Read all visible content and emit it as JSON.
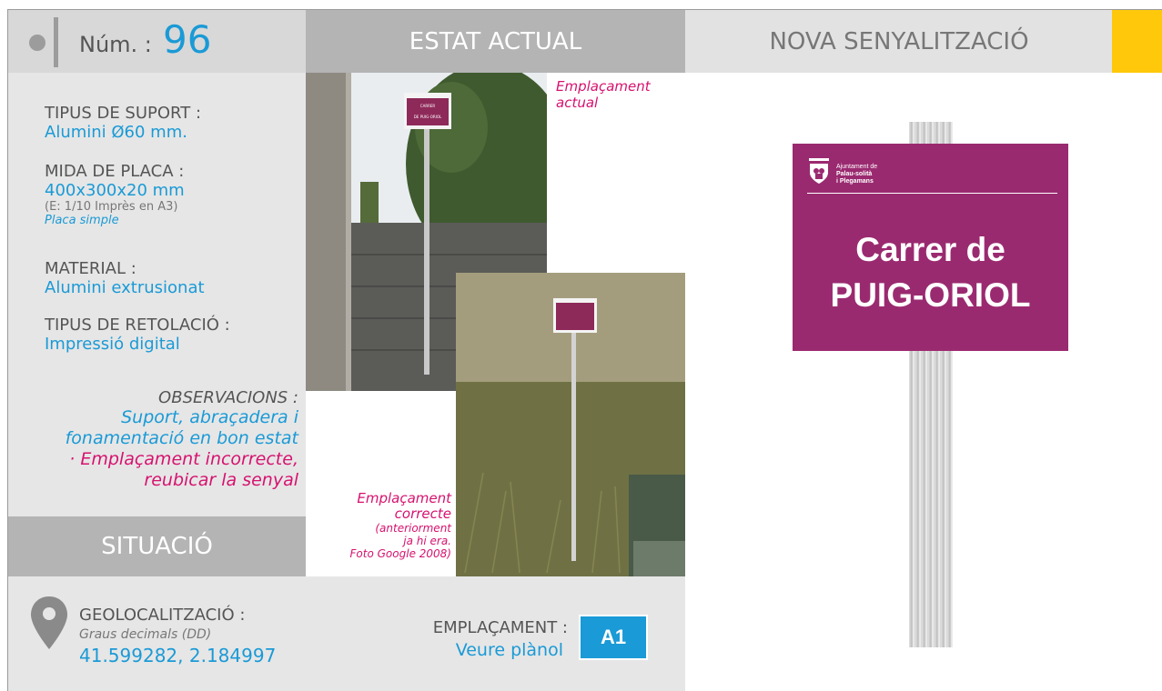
{
  "header": {
    "num_label": "Núm. :",
    "num_value": "96",
    "estat_actual": "ESTAT ACTUAL",
    "nova_senyalitzacio": "NOVA SENYALITZACIÓ",
    "accent_color": "#ffc80a"
  },
  "specs": {
    "suport_label": "TIPUS DE SUPORT :",
    "suport_value": "Alumini Ø60 mm.",
    "placa_label": "MIDA DE PLACA :",
    "placa_value": "400x300x20 mm",
    "placa_scale": "(E: 1/10 Imprès en A3)",
    "placa_type": "Placa simple",
    "material_label": "MATERIAL :",
    "material_value": "Alumini extrusionat",
    "retolacio_label": "TIPUS DE RETOLACIÓ :",
    "retolacio_value": "Impressió digital"
  },
  "observacions": {
    "label": "OBSERVACIONS :",
    "line1": "Suport, abraçadera i",
    "line2": "fonamentació en bon estat",
    "line3": "· Emplaçament incorrecte,",
    "line4": "reubicar la senyal"
  },
  "situacio": {
    "title": "SITUACIÓ",
    "geo_label": "GEOLOCALITZACIÓ :",
    "geo_sub": "Graus decimals (DD)",
    "geo_value": "41.599282, 2.184997"
  },
  "photos": {
    "caption1_line1": "Emplaçament",
    "caption1_line2": "actual",
    "caption2_line1": "Emplaçament",
    "caption2_line2": "correcte",
    "caption2_line3": "(anteriorment",
    "caption2_line4": "ja hi era.",
    "caption2_line5": "Foto Google 2008)",
    "sign_small_line1": "CARRER",
    "sign_small_line2": "DE PUIG-ORIOL"
  },
  "emplacament": {
    "label": "EMPLAÇAMENT :",
    "value": "Veure plànol",
    "badge": "A1"
  },
  "sign": {
    "logo_line1": "Ajuntament de",
    "logo_line2": "Palau-solità",
    "logo_line3": "i Plegamans",
    "name_line1": "Carrer de",
    "name_line2": "PUIG-ORIOL",
    "plate_color": "#9a2a70"
  }
}
